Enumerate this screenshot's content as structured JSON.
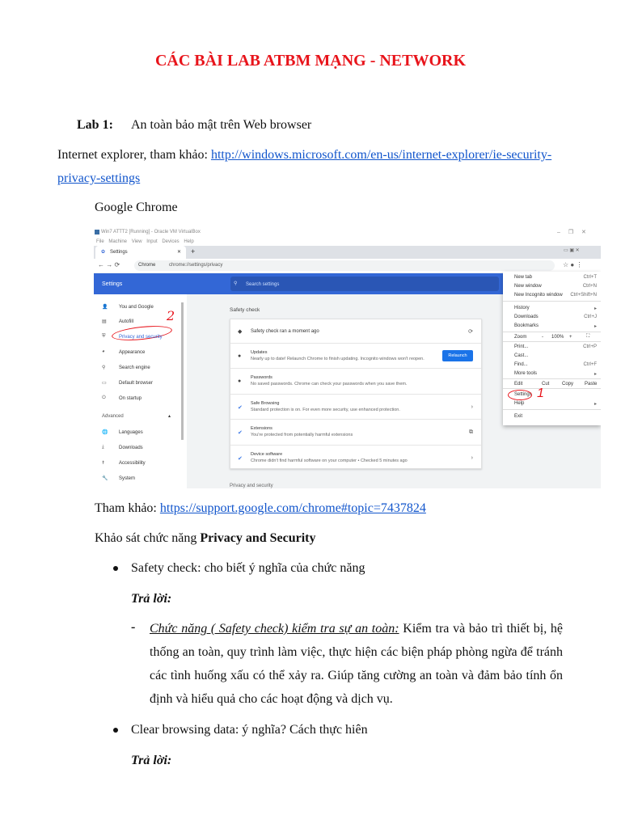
{
  "title": "CÁC BÀI LAB ATBM MẠNG - NETWORK",
  "lab": {
    "label": "Lab 1:",
    "text": "An toàn bảo mật trên Web browser"
  },
  "ie": {
    "prefix": "Internet explorer, tham khảo: ",
    "link_line1": "http://windows.microsoft.com/en-us/internet-explorer/ie-security-",
    "link_line2": "privacy-settings"
  },
  "chrome_heading": "Google Chrome",
  "screenshot": {
    "vm_title": "Win7 ATTT2 [Running] - Oracle VM VirtualBox",
    "vm_menu": [
      "File",
      "Machine",
      "View",
      "Input",
      "Devices",
      "Help"
    ],
    "tab_label": "Settings",
    "url_scheme": "Chrome",
    "url": "chrome://settings/privacy",
    "header_title": "Settings",
    "search_placeholder": "Search settings",
    "sidebar": [
      "You and Google",
      "Autofill",
      "Privacy and security",
      "Appearance",
      "Search engine",
      "Default browser",
      "On startup"
    ],
    "advanced": "Advanced",
    "advanced_items": [
      "Languages",
      "Downloads",
      "Accessibility",
      "System"
    ],
    "section_title": "Safety check",
    "rows": [
      {
        "title": "Safety check ran a moment ago",
        "desc": ""
      },
      {
        "title": "Updates",
        "desc": "Nearly up to date! Relaunch Chrome to finish updating. Incognito windows won't reopen."
      },
      {
        "title": "Passwords",
        "desc": "No saved passwords. Chrome can check your passwords when you save them."
      },
      {
        "title": "Safe Browsing",
        "desc": "Standard protection is on. For even more security, use enhanced protection."
      },
      {
        "title": "Extensions",
        "desc": "You're protected from potentially harmful extensions"
      },
      {
        "title": "Device software",
        "desc": "Chrome didn't find harmful software on your computer • Checked 5 minutes ago"
      }
    ],
    "relaunch": "Relaunch",
    "next_section": "Privacy and security",
    "menu": [
      {
        "label": "New tab",
        "shortcut": "Ctrl+T"
      },
      {
        "label": "New window",
        "shortcut": "Ctrl+N"
      },
      {
        "label": "New Incognito window",
        "shortcut": "Ctrl+Shift+N"
      },
      {
        "label": "History",
        "shortcut": "▸"
      },
      {
        "label": "Downloads",
        "shortcut": "Ctrl+J"
      },
      {
        "label": "Bookmarks",
        "shortcut": "▸"
      }
    ],
    "zoom": {
      "label": "Zoom",
      "minus": "-",
      "value": "100%",
      "plus": "+"
    },
    "menu2": [
      {
        "label": "Print...",
        "shortcut": "Ctrl+P"
      },
      {
        "label": "Cast...",
        "shortcut": ""
      },
      {
        "label": "Find...",
        "shortcut": "Ctrl+F"
      },
      {
        "label": "More tools",
        "shortcut": "▸"
      }
    ],
    "edit": {
      "label": "Edit",
      "cut": "Cut",
      "copy": "Copy",
      "paste": "Paste"
    },
    "menu3": [
      {
        "label": "Settings",
        "shortcut": ""
      },
      {
        "label": "Help",
        "shortcut": "▸"
      }
    ],
    "exit": "Exit",
    "annotation_1": "1",
    "annotation_2": "2",
    "accent": "#3367d6"
  },
  "ref": {
    "prefix": "Tham khảo: ",
    "link": "https://support.google.com/chrome#topic=7437824"
  },
  "survey": {
    "prefix": "Khảo sát chức năng ",
    "bold": "Privacy and Security"
  },
  "q1": "Safety check:  cho biết ý nghĩa của chức năng",
  "answer_label": "Trả lời:",
  "a1": {
    "dash": "-",
    "lead": "Chức năng ( Safety check) kiểm tra sự an toàn:",
    "text": " Kiểm tra và bảo trì thiết bị, hệ thống an toàn, quy trình làm việc, thực hiện các biện pháp phòng ngừa để tránh các tình huống xấu có thể xảy ra. Giúp tăng cường an toàn và đảm bảo tính ổn định và hiểu quả cho các hoạt động và dịch vụ."
  },
  "q2": "Clear browsing data: ý nghĩa? Cách thực hiên",
  "answer_label2": "Trả lời:"
}
